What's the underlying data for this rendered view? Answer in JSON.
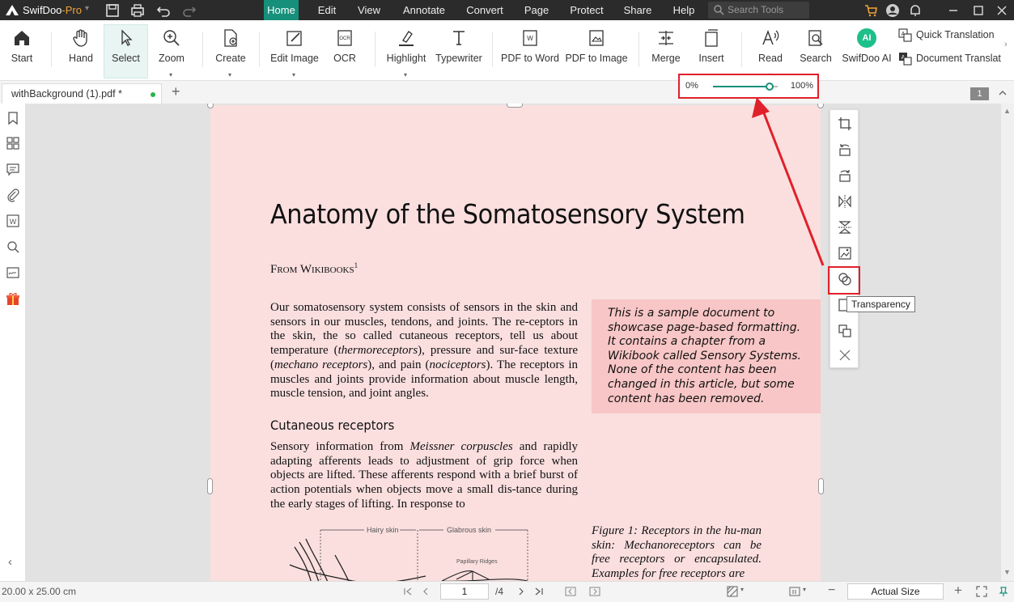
{
  "app": {
    "name_main": "SwifDoo",
    "name_suffix": "-Pro"
  },
  "menu": [
    "Home",
    "Edit",
    "View",
    "Annotate",
    "Convert",
    "Page",
    "Protect",
    "Share",
    "Help"
  ],
  "search_tools": {
    "placeholder": "Search Tools"
  },
  "ribbon": {
    "start": "Start",
    "hand": "Hand",
    "select": "Select",
    "zoom": "Zoom",
    "create": "Create",
    "edit_image": "Edit Image",
    "ocr": "OCR",
    "highlight": "Highlight",
    "typewriter": "Typewriter",
    "pdf_to_word": "PDF to Word",
    "pdf_to_image": "PDF to Image",
    "merge": "Merge",
    "insert": "Insert",
    "read": "Read",
    "search": "Search",
    "swifdoo_ai": "SwifDoo AI",
    "ai_badge": "AI",
    "quick_translation": "Quick Translation",
    "document_translation": "Document Translatio"
  },
  "tab": {
    "filename": "withBackground (1).pdf *"
  },
  "opacity_slider": {
    "min_label": "0%",
    "max_label": "100%",
    "value": 0.9
  },
  "page_badge": "1",
  "document": {
    "title": "Anatomy of the Somatosensory System",
    "source": "From Wikibooks",
    "source_sup": "1",
    "para1_a": "Our somatosensory system consists of sensors in the skin and sensors in our muscles, tendons, and joints. The re-ceptors in the skin, the so called cutaneous receptors, tell us about temperature (",
    "para1_b": "thermoreceptors",
    "para1_c": "), pressure and sur-face texture (",
    "para1_d": "mechano receptors",
    "para1_e": "), and pain (",
    "para1_f": "nociceptors",
    "para1_g": "). The receptors in muscles and joints provide information about muscle length, muscle tension, and joint angles.",
    "subheading": "Cutaneous receptors",
    "para2_a": "Sensory information from ",
    "para2_b": "Meissner corpuscles",
    "para2_c": " and rapidly adapting afferents leads to adjustment of grip force when objects are lifted. These afferents respond with a brief burst of action potentials when objects move a small dis-tance during the early stages of lifting. In response to",
    "note": "This is a sample document to showcase page-based formatting. It contains a chapter from a Wikibook called Sensory Systems. None of the content has been changed in this article, but some content has been removed.",
    "caption": "Figure 1:  Receptors in the hu-man skin: Mechanoreceptors can be free receptors or encapsulated. Examples for free receptors are",
    "figure_labels": {
      "hairy": "Hairy skin",
      "glabrous": "Glabrous skin",
      "papillary": "Papillary Ridges"
    }
  },
  "tooltip": "Transparency",
  "status": {
    "page_size": "20.00 x 25.00 cm",
    "page_input": "1",
    "page_total": "/4",
    "zoom": "Actual Size"
  }
}
